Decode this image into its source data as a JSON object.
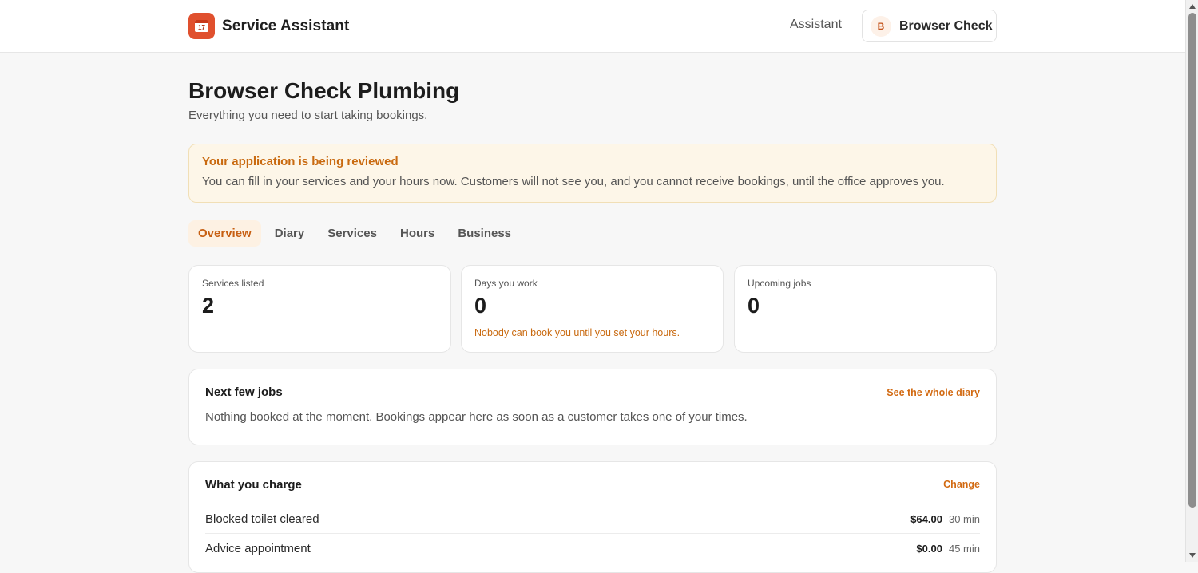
{
  "header": {
    "brand": "Service Assistant",
    "logo_icon": "calendar-icon",
    "logo_day": "17",
    "nav_assistant": "Assistant",
    "account_initial": "B",
    "account_name": "Browser Check Plumbing"
  },
  "page": {
    "title": "Browser Check Plumbing",
    "subtitle": "Everything you need to start taking bookings."
  },
  "alert": {
    "title": "Your application is being reviewed",
    "text": "You can fill in your services and your hours now. Customers will not see you, and you cannot receive bookings, until the office approves you."
  },
  "tabs": [
    {
      "label": "Overview",
      "active": true
    },
    {
      "label": "Diary",
      "active": false
    },
    {
      "label": "Services",
      "active": false
    },
    {
      "label": "Hours",
      "active": false
    },
    {
      "label": "Business",
      "active": false
    }
  ],
  "stats": [
    {
      "label": "Services listed",
      "value": "2",
      "note": ""
    },
    {
      "label": "Days you work",
      "value": "0",
      "note": "Nobody can book you until you set your hours."
    },
    {
      "label": "Upcoming jobs",
      "value": "0",
      "note": ""
    }
  ],
  "jobs": {
    "title": "Next few jobs",
    "link": "See the whole diary",
    "empty": "Nothing booked at the moment. Bookings appear here as soon as a customer takes one of your times."
  },
  "charges": {
    "title": "What you charge",
    "link": "Change",
    "items": [
      {
        "name": "Blocked toilet cleared",
        "price": "$64.00",
        "duration": "30 min"
      },
      {
        "name": "Advice appointment",
        "price": "$0.00",
        "duration": "45 min"
      }
    ]
  },
  "colors": {
    "accent": "#c96a10",
    "logo_bg": "#e0502e",
    "alert_bg": "#fdf6e8"
  }
}
